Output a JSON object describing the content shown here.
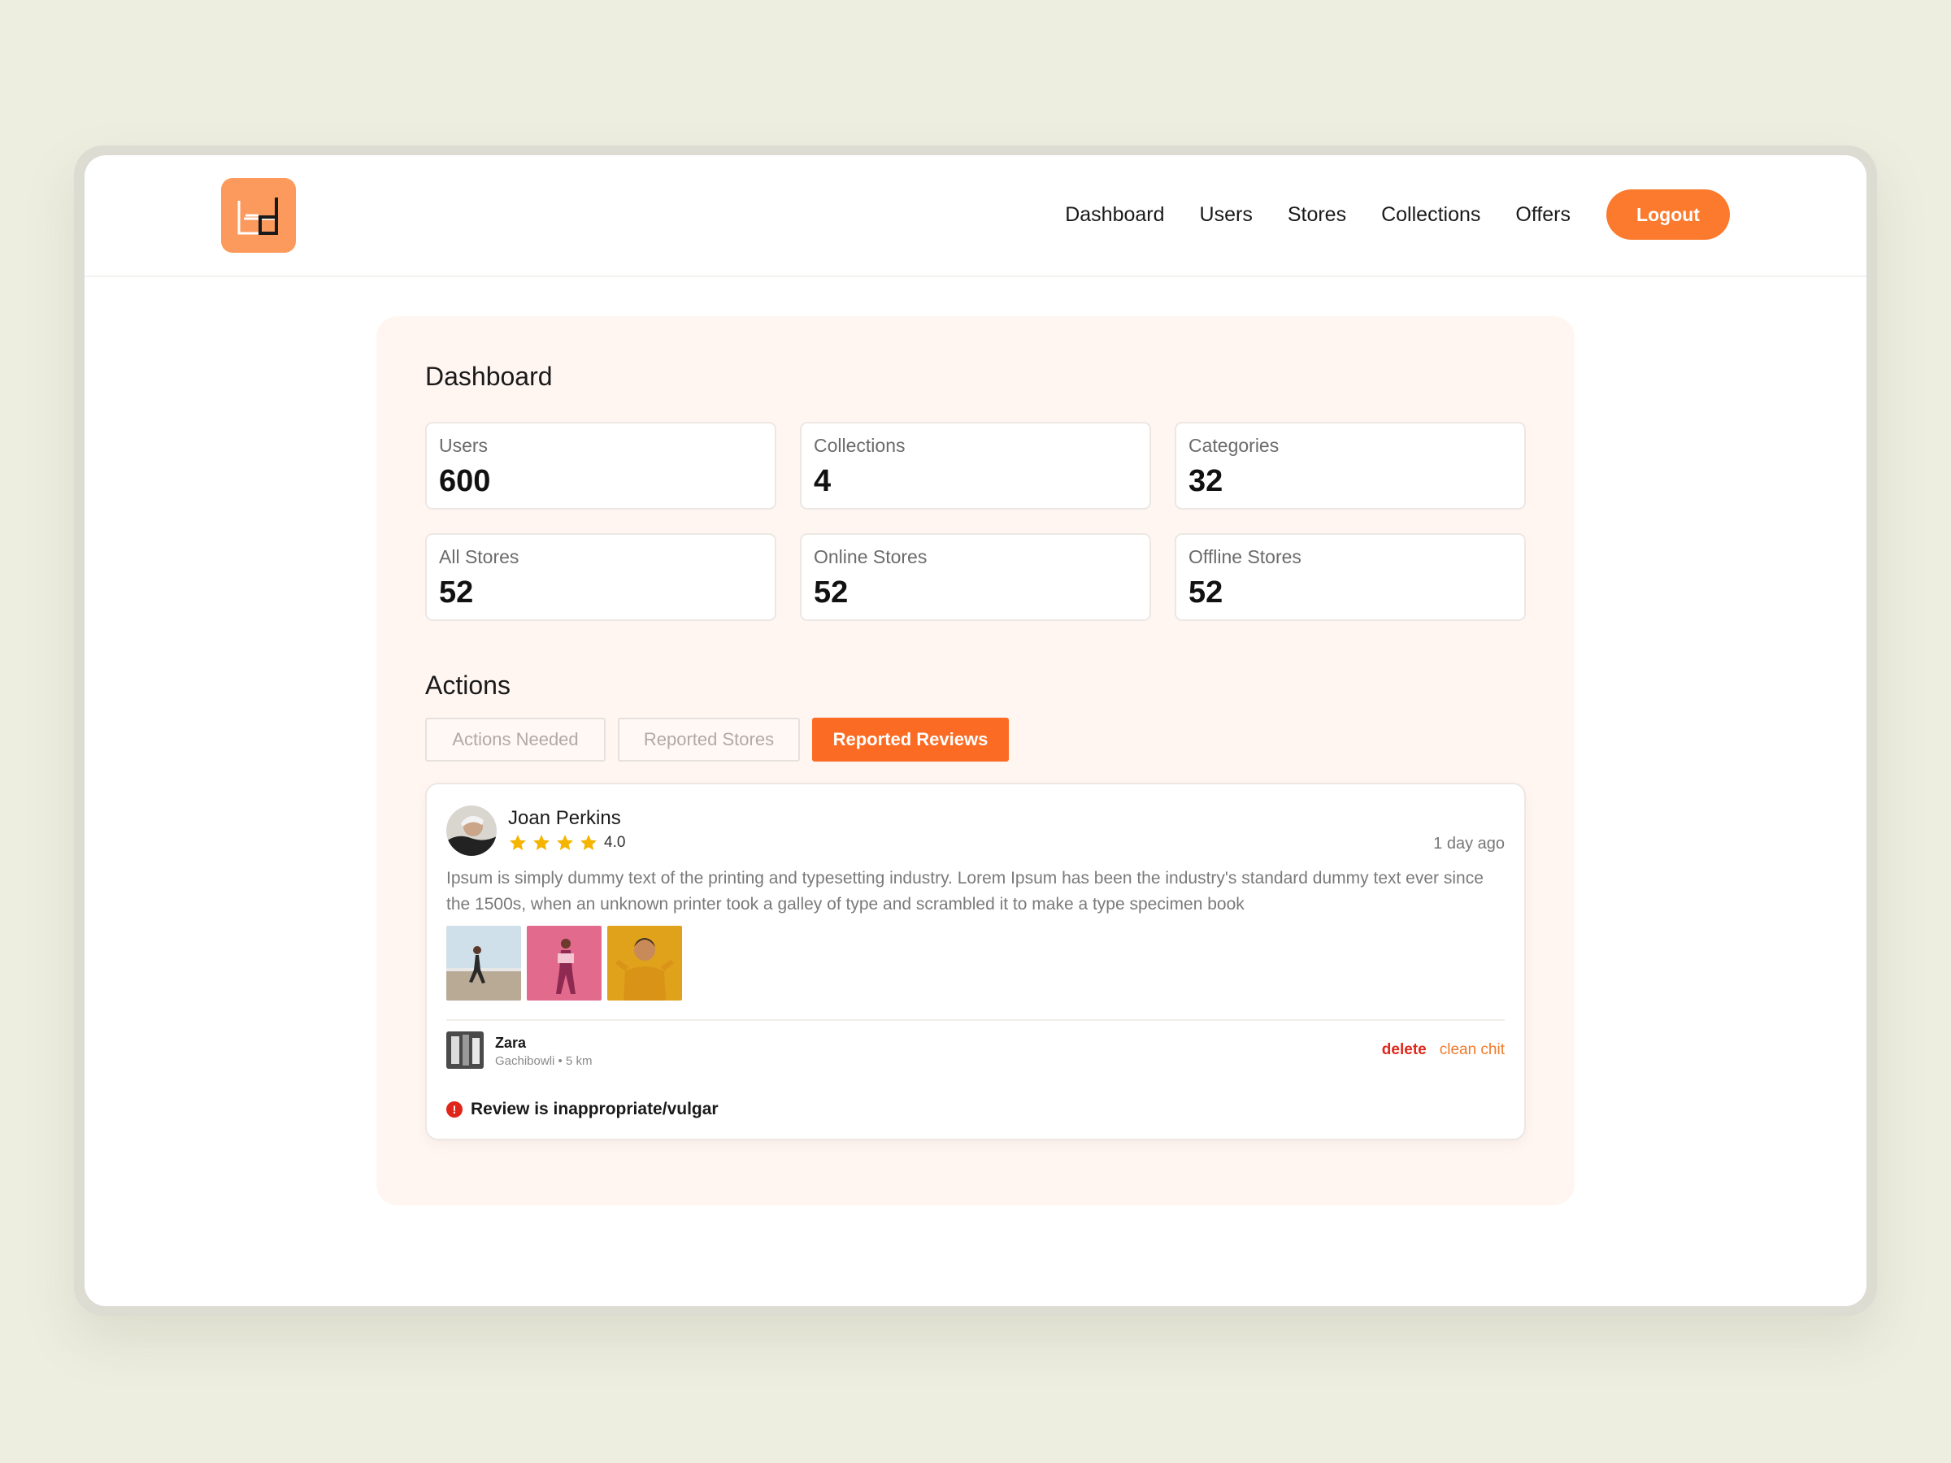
{
  "nav": {
    "items": [
      {
        "label": "Dashboard"
      },
      {
        "label": "Users"
      },
      {
        "label": "Stores"
      },
      {
        "label": "Collections"
      },
      {
        "label": "Offers"
      }
    ],
    "logout_label": "Logout"
  },
  "logo": {
    "icon": "bd-logo-icon",
    "color": "#fb9a5c"
  },
  "dashboard": {
    "title": "Dashboard",
    "stats": [
      {
        "label": "Users",
        "value": "600"
      },
      {
        "label": "Collections",
        "value": "4"
      },
      {
        "label": "Categories",
        "value": "32"
      },
      {
        "label": "All Stores",
        "value": "52"
      },
      {
        "label": "Online Stores",
        "value": "52"
      },
      {
        "label": "Offline Stores",
        "value": "52"
      }
    ]
  },
  "actions": {
    "title": "Actions",
    "tabs": [
      {
        "label": "Actions Needed",
        "active": false
      },
      {
        "label": "Reported Stores",
        "active": false
      },
      {
        "label": "Reported Reviews",
        "active": true
      }
    ]
  },
  "review": {
    "reviewer": "Joan Perkins",
    "rating": 4,
    "rating_text": "4.0",
    "time": "1 day ago",
    "text": "Ipsum is simply dummy text of the printing and typesetting industry. Lorem Ipsum has been the industry's standard dummy text ever since the 1500s, when an unknown printer took a galley of type and scrambled it to make a type specimen book",
    "store": {
      "name": "Zara",
      "meta": "Gachibowli • 5 km"
    },
    "delete_label": "delete",
    "clean_label": "clean chit",
    "reason": "Review is inappropriate/vulgar"
  },
  "colors": {
    "accent": "#fb6b23",
    "danger": "#e0261a",
    "star": "#f5b400"
  }
}
